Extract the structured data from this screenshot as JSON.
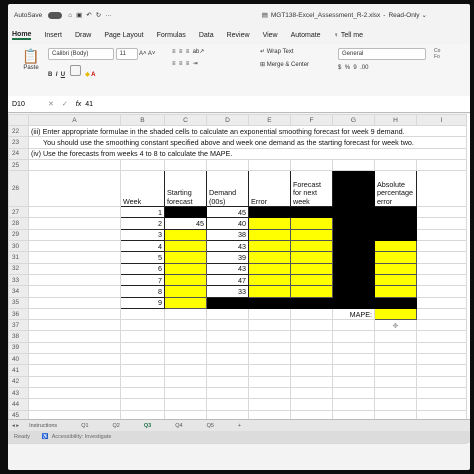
{
  "titlebar": {
    "autosave": "AutoSave",
    "filename": "MGT138-Excel_Assessment_R-2.xlsx",
    "mode": "Read-Only"
  },
  "menu": [
    "Home",
    "Insert",
    "Draw",
    "Page Layout",
    "Formulas",
    "Data",
    "Review",
    "View",
    "Automate",
    "Tell me"
  ],
  "ribbon": {
    "paste": "Paste",
    "font": "Calibri (Body)",
    "size": "11",
    "wrap": "Wrap Text",
    "merge": "Merge & Center",
    "number_format": "General",
    "percent": "%",
    "comma": "9"
  },
  "formula": {
    "cell_ref": "D10",
    "fx": "fx",
    "value": "41"
  },
  "columns": [
    "A",
    "B",
    "C",
    "D",
    "E",
    "F",
    "G",
    "H",
    "I"
  ],
  "instructions": {
    "r22": "(iii) Enter appropriate formulae in the shaded cells to calculate an exponential smoothing forecast for week 9 demand.",
    "r23": "You should use the smoothing constant specified above and week one demand as the starting forecast for week two.",
    "r24": "(iv) Use the forecasts from weeks 4 to 8 to calculate the MAPE."
  },
  "table": {
    "headers": {
      "week": "Week",
      "starting": "Starting forecast",
      "demand": "Demand (00s)",
      "error": "Error",
      "forecast_next": "Forecast for next week",
      "ape": "Absolute percentage error"
    },
    "weeks": [
      "1",
      "2",
      "3",
      "4",
      "5",
      "6",
      "7",
      "8",
      "9"
    ],
    "starting": [
      "",
      "45",
      "",
      "",
      "",
      "",
      "",
      "",
      ""
    ],
    "demand": [
      "45",
      "40",
      "38",
      "43",
      "39",
      "43",
      "47",
      "33",
      ""
    ],
    "mape_label": "MAPE:"
  },
  "sheets": [
    "Instructions",
    "Q1",
    "Q2",
    "Q3",
    "Q4",
    "Q5",
    "+"
  ],
  "status": {
    "ready": "Ready",
    "accessibility": "Accessibility: Investigate"
  }
}
